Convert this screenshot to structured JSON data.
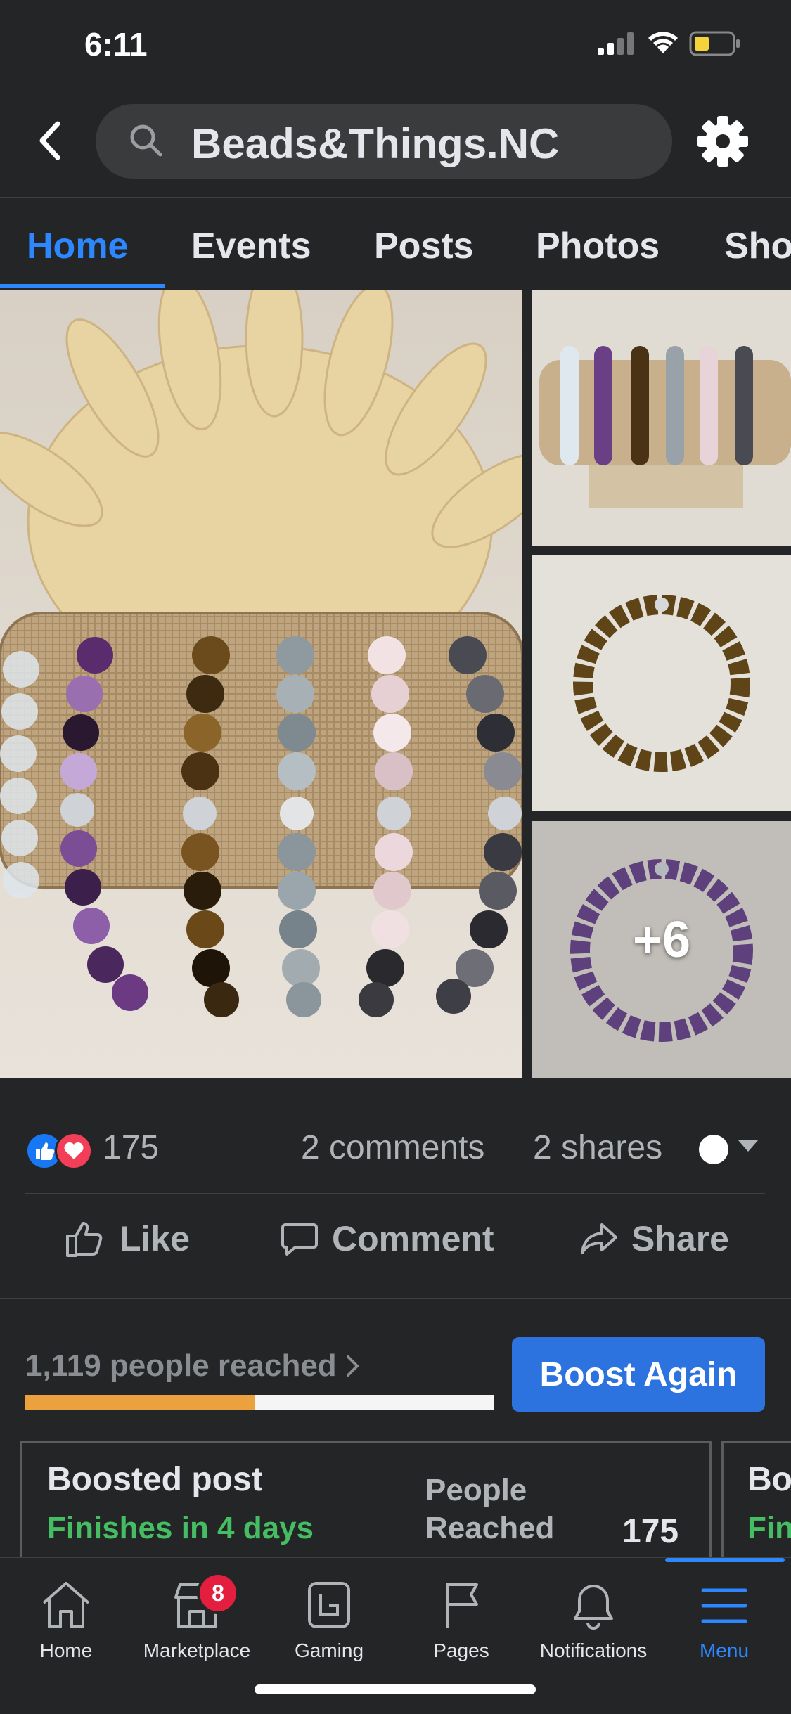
{
  "status_bar": {
    "time": "6:11"
  },
  "search": {
    "query": "Beads&Things.NC"
  },
  "tabs": [
    {
      "label": "Home",
      "active": true
    },
    {
      "label": "Events",
      "active": false
    },
    {
      "label": "Posts",
      "active": false
    },
    {
      "label": "Photos",
      "active": false
    },
    {
      "label": "Sho",
      "active": false
    }
  ],
  "photos": {
    "more_count": "+6"
  },
  "reactions": {
    "count": "175",
    "comments": "2 comments",
    "shares": "2 shares"
  },
  "actions": {
    "like": "Like",
    "comment": "Comment",
    "share": "Share"
  },
  "reach": {
    "label": "1,119 people reached",
    "progress_fraction": 0.49,
    "boost_button": "Boost Again"
  },
  "boost_cards": [
    {
      "title": "Boosted post",
      "status": "Finishes in 4 days",
      "metric_label_line1": "People",
      "metric_label_line2": "Reached",
      "metric_value": "175"
    },
    {
      "title": "Bo",
      "status": "Fin"
    }
  ],
  "bottom_nav": {
    "items": [
      {
        "label": "Home",
        "icon": "home-icon",
        "active": false
      },
      {
        "label": "Marketplace",
        "icon": "marketplace-icon",
        "active": false,
        "badge": "8"
      },
      {
        "label": "Gaming",
        "icon": "gaming-icon",
        "active": false
      },
      {
        "label": "Pages",
        "icon": "flag-icon",
        "active": false
      },
      {
        "label": "Notifications",
        "icon": "bell-icon",
        "active": false
      },
      {
        "label": "Menu",
        "icon": "menu-icon",
        "active": true
      }
    ]
  },
  "colors": {
    "background": "#242526",
    "accent": "#2d88ff",
    "boost_button": "#2d73e0",
    "progress": "#eba13d",
    "status_green": "#45bd62",
    "badge": "#e41e3f"
  }
}
